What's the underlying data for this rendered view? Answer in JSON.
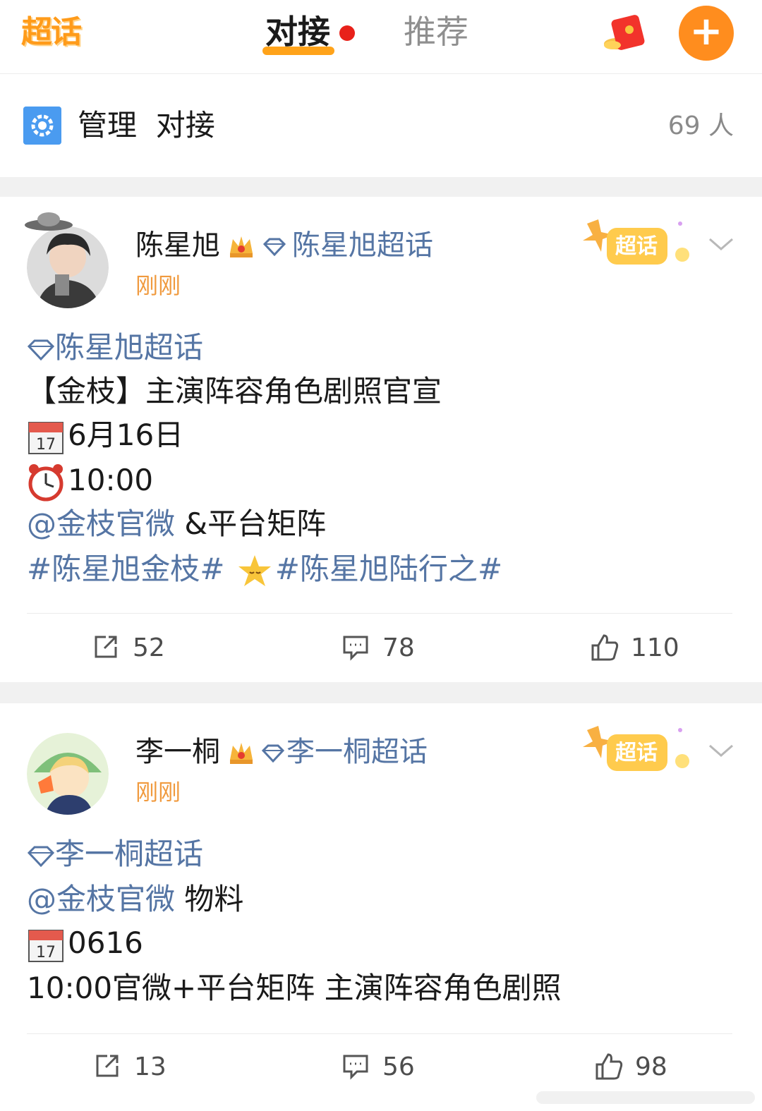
{
  "header": {
    "logo": "超话",
    "tabs": [
      {
        "label": "对接",
        "active": true,
        "has_dot": true
      },
      {
        "label": "推荐",
        "active": false
      }
    ],
    "add_button": "+"
  },
  "manage": {
    "title": "管理  对接",
    "count": "69 人"
  },
  "posts": [
    {
      "author": "陈星旭",
      "topic": "陈星旭超话",
      "time": "刚刚",
      "badge": "超话",
      "lines": {
        "topic": "陈星旭超话",
        "title": "【金枝】主演阵容角色剧照官宣",
        "date": "6月16日",
        "clock": "10:00",
        "mention": "@金枝官微",
        "mention_rest": " &平台矩阵",
        "tag1": "#陈星旭金枝#",
        "tag2": "#陈星旭陆行之#"
      },
      "actions": {
        "repost": "52",
        "comment": "78",
        "like": "110"
      }
    },
    {
      "author": "李一桐",
      "topic": "李一桐超话",
      "time": "刚刚",
      "badge": "超话",
      "lines": {
        "topic": "李一桐超话",
        "mention": "@金枝官微",
        "mention_rest": " 物料",
        "date": "0616",
        "text": "10:00官微+平台矩阵 主演阵容角色剧照"
      },
      "actions": {
        "repost": "13",
        "comment": "56",
        "like": "98"
      }
    }
  ],
  "colors": {
    "accent": "#ffa31a",
    "link": "#5575a4",
    "time": "#f09a3e",
    "separator": "#f1f1f1"
  }
}
